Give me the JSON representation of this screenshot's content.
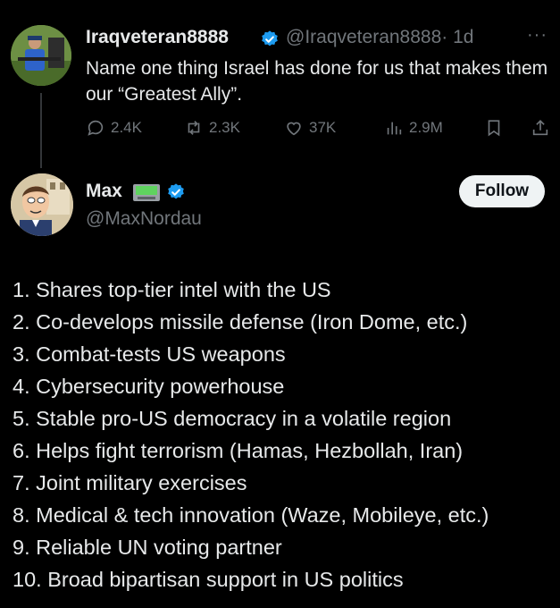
{
  "parent_tweet": {
    "display_name": "Iraqveteran8888",
    "handle": "@Iraqveteran8888",
    "time": "· 1d",
    "more_icon": "more-horizontal-icon",
    "text": "Name one thing Israel has done for us that makes them our “Greatest Ally”.",
    "stats": {
      "replies": "2.4K",
      "reposts": "2.3K",
      "likes": "37K",
      "views": "2.9M"
    }
  },
  "reply_tweet": {
    "display_name": "Max",
    "handle": "@MaxNordau",
    "emoji": "computer-icon",
    "follow_label": "Follow",
    "list_items": [
      "1. Shares top-tier intel with the US",
      "2. Co-develops missile defense (Iron Dome, etc.)",
      "3. Combat-tests US weapons",
      "4. Cybersecurity powerhouse",
      "5. Stable pro-US democracy in a volatile region",
      "6. Helps fight terrorism (Hamas, Hezbollah, Iran)",
      "7. Joint military exercises",
      "8. Medical & tech innovation (Waze, Mobileye, etc.)",
      "9. Reliable UN voting partner",
      "10. Broad bipartisan support in US politics"
    ]
  },
  "colors": {
    "background": "#000000",
    "text_primary": "#e7e9ea",
    "text_secondary": "#71767b",
    "verified_blue": "#1d9bf0",
    "follow_bg": "#eff3f4"
  }
}
